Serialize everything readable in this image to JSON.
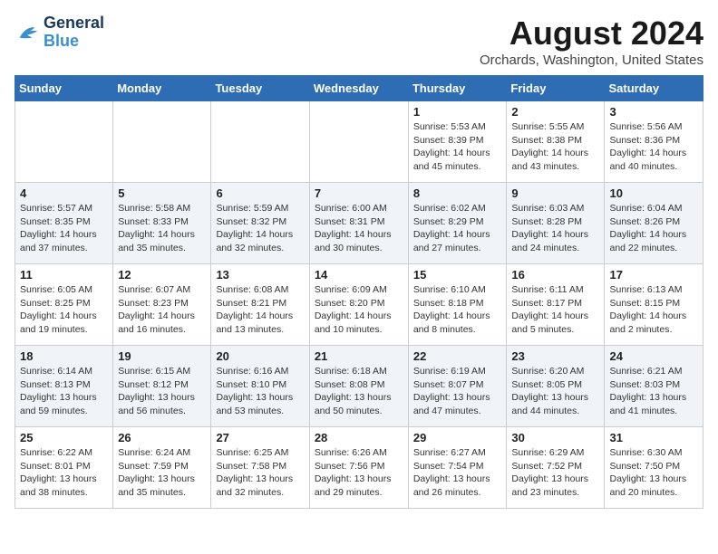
{
  "logo": {
    "line1": "General",
    "line2": "Blue"
  },
  "title": "August 2024",
  "location": "Orchards, Washington, United States",
  "days_header": [
    "Sunday",
    "Monday",
    "Tuesday",
    "Wednesday",
    "Thursday",
    "Friday",
    "Saturday"
  ],
  "weeks": [
    [
      {
        "day": "",
        "info": ""
      },
      {
        "day": "",
        "info": ""
      },
      {
        "day": "",
        "info": ""
      },
      {
        "day": "",
        "info": ""
      },
      {
        "day": "1",
        "info": "Sunrise: 5:53 AM\nSunset: 8:39 PM\nDaylight: 14 hours\nand 45 minutes."
      },
      {
        "day": "2",
        "info": "Sunrise: 5:55 AM\nSunset: 8:38 PM\nDaylight: 14 hours\nand 43 minutes."
      },
      {
        "day": "3",
        "info": "Sunrise: 5:56 AM\nSunset: 8:36 PM\nDaylight: 14 hours\nand 40 minutes."
      }
    ],
    [
      {
        "day": "4",
        "info": "Sunrise: 5:57 AM\nSunset: 8:35 PM\nDaylight: 14 hours\nand 37 minutes."
      },
      {
        "day": "5",
        "info": "Sunrise: 5:58 AM\nSunset: 8:33 PM\nDaylight: 14 hours\nand 35 minutes."
      },
      {
        "day": "6",
        "info": "Sunrise: 5:59 AM\nSunset: 8:32 PM\nDaylight: 14 hours\nand 32 minutes."
      },
      {
        "day": "7",
        "info": "Sunrise: 6:00 AM\nSunset: 8:31 PM\nDaylight: 14 hours\nand 30 minutes."
      },
      {
        "day": "8",
        "info": "Sunrise: 6:02 AM\nSunset: 8:29 PM\nDaylight: 14 hours\nand 27 minutes."
      },
      {
        "day": "9",
        "info": "Sunrise: 6:03 AM\nSunset: 8:28 PM\nDaylight: 14 hours\nand 24 minutes."
      },
      {
        "day": "10",
        "info": "Sunrise: 6:04 AM\nSunset: 8:26 PM\nDaylight: 14 hours\nand 22 minutes."
      }
    ],
    [
      {
        "day": "11",
        "info": "Sunrise: 6:05 AM\nSunset: 8:25 PM\nDaylight: 14 hours\nand 19 minutes."
      },
      {
        "day": "12",
        "info": "Sunrise: 6:07 AM\nSunset: 8:23 PM\nDaylight: 14 hours\nand 16 minutes."
      },
      {
        "day": "13",
        "info": "Sunrise: 6:08 AM\nSunset: 8:21 PM\nDaylight: 14 hours\nand 13 minutes."
      },
      {
        "day": "14",
        "info": "Sunrise: 6:09 AM\nSunset: 8:20 PM\nDaylight: 14 hours\nand 10 minutes."
      },
      {
        "day": "15",
        "info": "Sunrise: 6:10 AM\nSunset: 8:18 PM\nDaylight: 14 hours\nand 8 minutes."
      },
      {
        "day": "16",
        "info": "Sunrise: 6:11 AM\nSunset: 8:17 PM\nDaylight: 14 hours\nand 5 minutes."
      },
      {
        "day": "17",
        "info": "Sunrise: 6:13 AM\nSunset: 8:15 PM\nDaylight: 14 hours\nand 2 minutes."
      }
    ],
    [
      {
        "day": "18",
        "info": "Sunrise: 6:14 AM\nSunset: 8:13 PM\nDaylight: 13 hours\nand 59 minutes."
      },
      {
        "day": "19",
        "info": "Sunrise: 6:15 AM\nSunset: 8:12 PM\nDaylight: 13 hours\nand 56 minutes."
      },
      {
        "day": "20",
        "info": "Sunrise: 6:16 AM\nSunset: 8:10 PM\nDaylight: 13 hours\nand 53 minutes."
      },
      {
        "day": "21",
        "info": "Sunrise: 6:18 AM\nSunset: 8:08 PM\nDaylight: 13 hours\nand 50 minutes."
      },
      {
        "day": "22",
        "info": "Sunrise: 6:19 AM\nSunset: 8:07 PM\nDaylight: 13 hours\nand 47 minutes."
      },
      {
        "day": "23",
        "info": "Sunrise: 6:20 AM\nSunset: 8:05 PM\nDaylight: 13 hours\nand 44 minutes."
      },
      {
        "day": "24",
        "info": "Sunrise: 6:21 AM\nSunset: 8:03 PM\nDaylight: 13 hours\nand 41 minutes."
      }
    ],
    [
      {
        "day": "25",
        "info": "Sunrise: 6:22 AM\nSunset: 8:01 PM\nDaylight: 13 hours\nand 38 minutes."
      },
      {
        "day": "26",
        "info": "Sunrise: 6:24 AM\nSunset: 7:59 PM\nDaylight: 13 hours\nand 35 minutes."
      },
      {
        "day": "27",
        "info": "Sunrise: 6:25 AM\nSunset: 7:58 PM\nDaylight: 13 hours\nand 32 minutes."
      },
      {
        "day": "28",
        "info": "Sunrise: 6:26 AM\nSunset: 7:56 PM\nDaylight: 13 hours\nand 29 minutes."
      },
      {
        "day": "29",
        "info": "Sunrise: 6:27 AM\nSunset: 7:54 PM\nDaylight: 13 hours\nand 26 minutes."
      },
      {
        "day": "30",
        "info": "Sunrise: 6:29 AM\nSunset: 7:52 PM\nDaylight: 13 hours\nand 23 minutes."
      },
      {
        "day": "31",
        "info": "Sunrise: 6:30 AM\nSunset: 7:50 PM\nDaylight: 13 hours\nand 20 minutes."
      }
    ]
  ]
}
